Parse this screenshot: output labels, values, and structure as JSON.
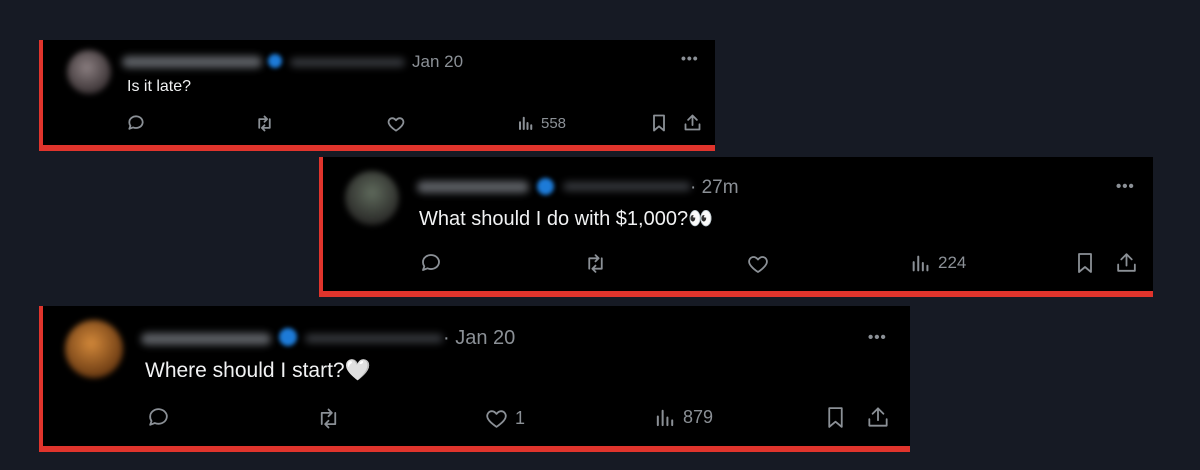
{
  "tweets": [
    {
      "time": "Jan 20",
      "text": "Is it late?",
      "likes": "",
      "views": "558"
    },
    {
      "time": "· 27m",
      "text": "What should I do with $1,000?👀",
      "likes": "",
      "views": "224"
    },
    {
      "time": "· Jan 20",
      "text": "Where should I start?🤍",
      "likes": "1",
      "views": "879"
    }
  ],
  "icons": [
    "reply-icon",
    "retweet-icon",
    "like-icon",
    "views-icon",
    "bookmark-icon",
    "share-icon",
    "more-icon"
  ],
  "colors": {
    "highlight": "#e0342c",
    "card_bg": "#000000",
    "page_bg": "#161a24",
    "muted": "#8b9096",
    "verified": "#1d7bd8"
  }
}
